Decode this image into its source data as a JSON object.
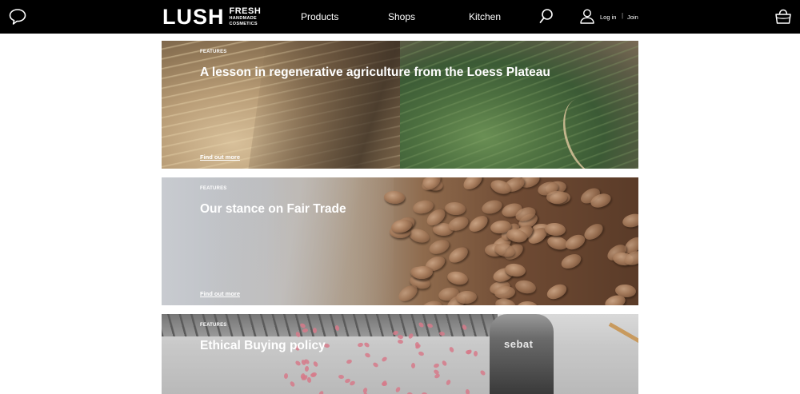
{
  "header": {
    "brand_main": "LUSH",
    "brand_fresh": "FRESH",
    "brand_line1": "HANDMADE",
    "brand_line2": "COSMETICS",
    "nav": [
      {
        "label": "Products"
      },
      {
        "label": "Shops"
      },
      {
        "label": "Kitchen"
      }
    ],
    "login_label": "Log in",
    "divider": "|",
    "join_label": "Join",
    "icons": [
      "chat-icon",
      "search-icon",
      "user-icon",
      "basket-icon"
    ]
  },
  "features": [
    {
      "overline": "FEATURES",
      "title": "A lesson in regenerative agriculture from the Loess Plateau",
      "cta": "Find out more"
    },
    {
      "overline": "FEATURES",
      "title": "Our stance on Fair Trade",
      "cta": "Find out more"
    },
    {
      "overline": "FEATURES",
      "title": "Ethical Buying policy",
      "apron_text": "sebat"
    }
  ],
  "colors": {
    "header_bg": "#000000",
    "header_text": "#ffffff",
    "page_bg": "#ffffff"
  }
}
